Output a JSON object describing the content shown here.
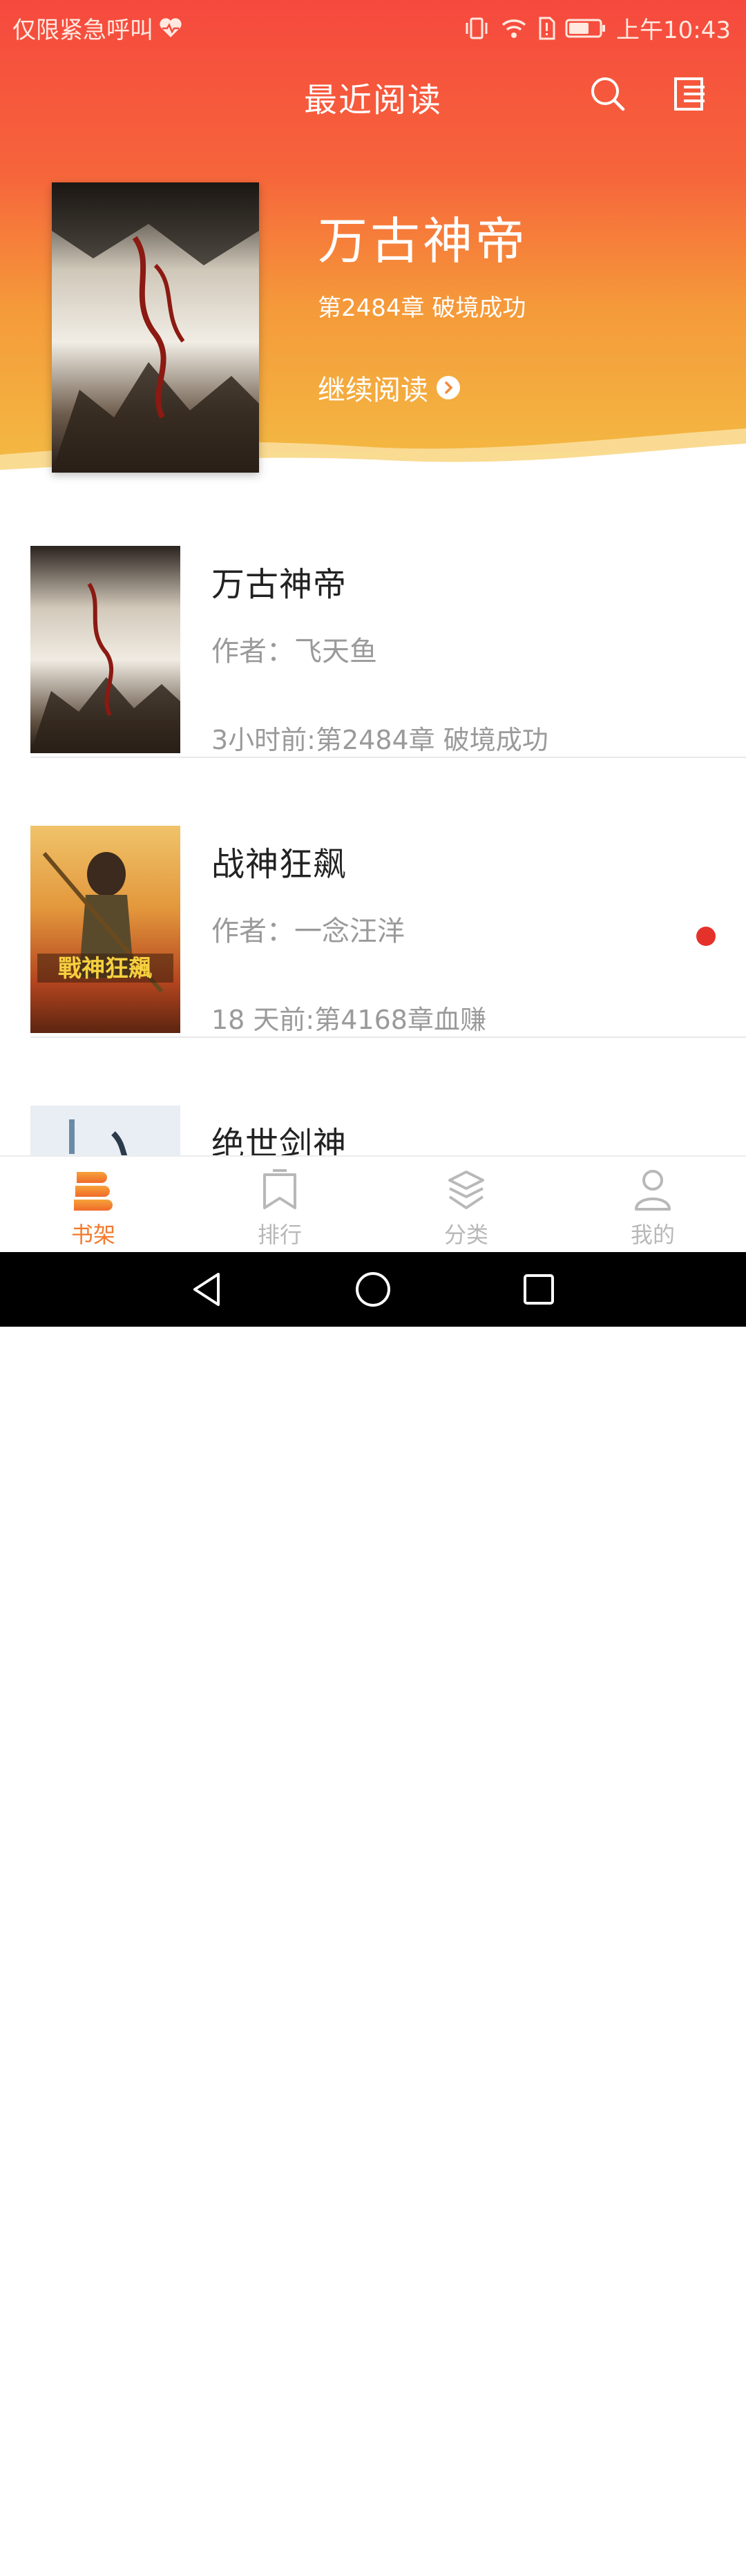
{
  "status_bar": {
    "left_text": "仅限紧急呼叫",
    "time": "上午10:43",
    "icons": [
      "heart-pulse-icon",
      "vibrate-icon",
      "wifi-icon",
      "sim-alert-icon",
      "battery-icon"
    ]
  },
  "nav": {
    "title": "最近阅读",
    "icons": [
      "search-icon",
      "menu-list-icon"
    ]
  },
  "hero": {
    "title": "万古神帝",
    "chapter": "第2484章 破境成功",
    "continue_label": "继续阅读"
  },
  "books": [
    {
      "title": "万古神帝",
      "author": "作者：飞天鱼",
      "progress": "3小时前:第2484章 破境成功",
      "unread": false
    },
    {
      "title": "战神狂飙",
      "author": "作者：一念汪洋",
      "progress": "18 天前:第4168章血赚",
      "unread": true
    },
    {
      "title": "绝世剑神",
      "author": "",
      "progress": "",
      "unread": false
    }
  ],
  "tabs": [
    {
      "label": "书架",
      "icon": "bookshelf-icon",
      "active": true
    },
    {
      "label": "排行",
      "icon": "ranking-icon",
      "active": false
    },
    {
      "label": "分类",
      "icon": "category-icon",
      "active": false
    },
    {
      "label": "我的",
      "icon": "profile-icon",
      "active": false
    }
  ],
  "colors": {
    "header_top": "#f6493e",
    "header_bottom": "#f3c044",
    "active_tab": "#f47a2c",
    "unread_dot": "#e4322b"
  }
}
